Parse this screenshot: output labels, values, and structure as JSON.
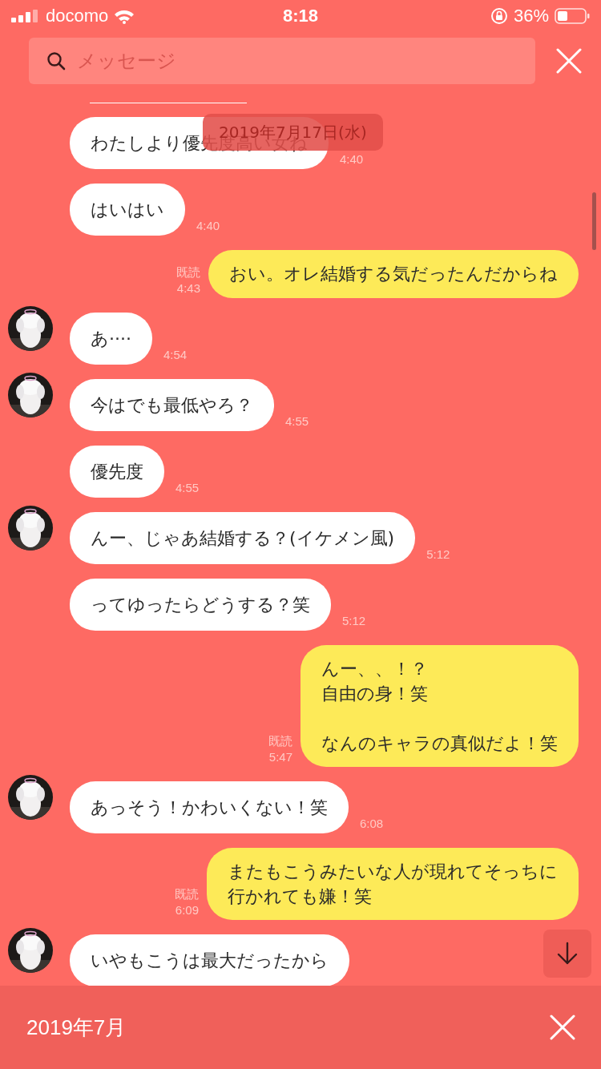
{
  "status_bar": {
    "carrier": "docomo",
    "time": "8:18",
    "battery": "36%"
  },
  "search": {
    "placeholder": "メッセージ"
  },
  "date_label": "2019年7月17日(水)",
  "messages": [
    {
      "kind": "in",
      "avatar": false,
      "text": "わたしより優先度高い女ね",
      "time": "4:40"
    },
    {
      "kind": "in",
      "avatar": false,
      "text": "はいはい",
      "time": "4:40"
    },
    {
      "kind": "out",
      "read": "既読",
      "text": "おい。オレ結婚する気だったんだからね",
      "time": "4:43"
    },
    {
      "kind": "in",
      "avatar": true,
      "text": "あ····",
      "time": "4:54"
    },
    {
      "kind": "in",
      "avatar": true,
      "text": "今はでも最低やろ？",
      "time": "4:55"
    },
    {
      "kind": "in",
      "avatar": false,
      "text": "優先度",
      "time": "4:55"
    },
    {
      "kind": "in",
      "avatar": true,
      "text": "んー、じゃあ結婚する？(イケメン風)",
      "time": "5:12"
    },
    {
      "kind": "in",
      "avatar": false,
      "text": "ってゆったらどうする？笑",
      "time": "5:12"
    },
    {
      "kind": "out",
      "read": "既読",
      "paragraphs": [
        [
          "んー、、！？",
          "自由の身！笑"
        ],
        [
          "なんのキャラの真似だよ！笑"
        ]
      ],
      "time": "5:47"
    },
    {
      "kind": "in",
      "avatar": true,
      "text": "あっそう！かわいくない！笑",
      "time": "6:08"
    },
    {
      "kind": "out",
      "read": "既読",
      "paragraphs": [
        [
          "またもこうみたいな人が現れてそっちに",
          "行かれても嫌！笑"
        ]
      ],
      "time": "6:09"
    },
    {
      "kind": "in",
      "avatar": true,
      "text": "いやもこうは最大だったから"
    }
  ],
  "footer": {
    "month": "2019年7月"
  }
}
